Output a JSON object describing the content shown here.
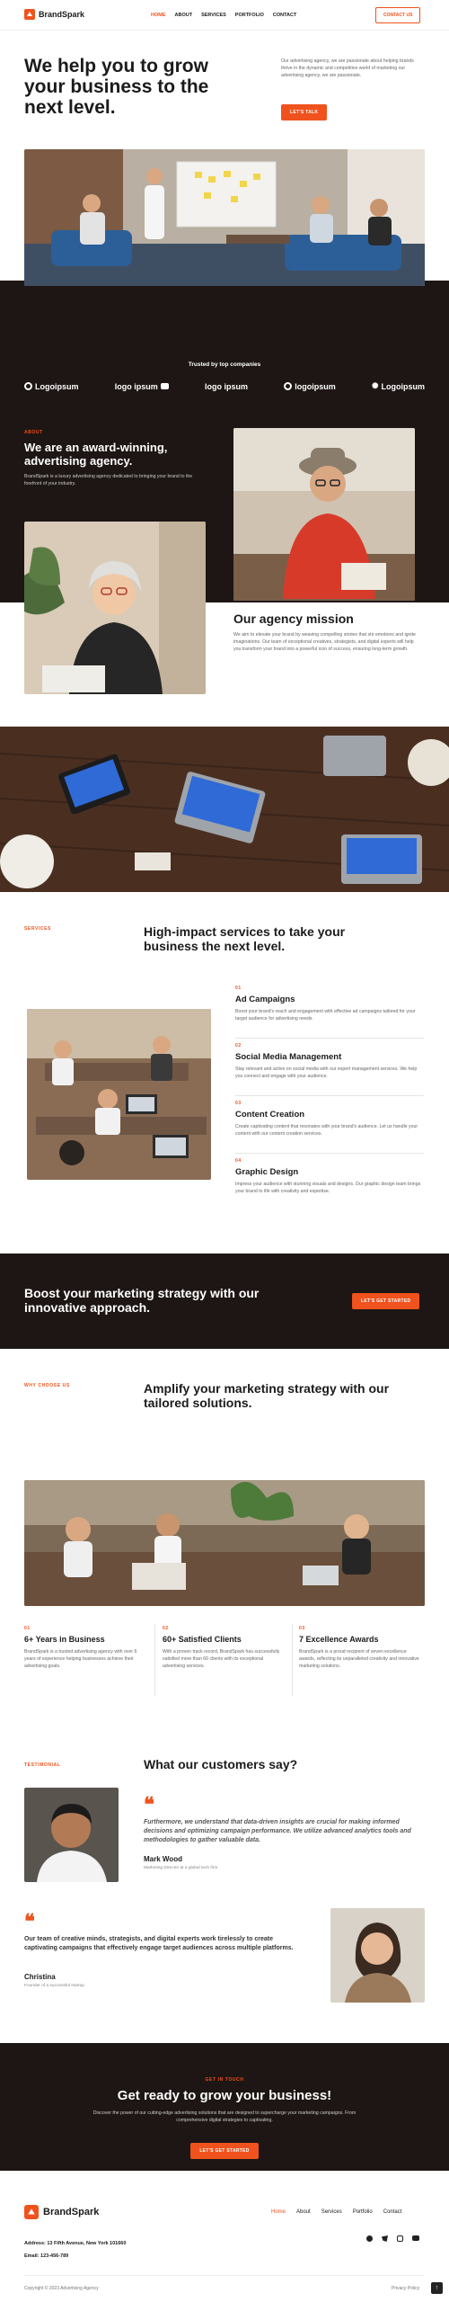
{
  "nav": {
    "brand": "BrandSpark",
    "links": [
      "HOME",
      "ABOUT",
      "SERVICES",
      "PORTFOLIO",
      "CONTACT"
    ],
    "cta": "CONTACT US"
  },
  "hero": {
    "title": "We help you to grow your business to the next level.",
    "text": "Our advertising agency, we are passionate about helping brands thrive in the dynamic and competitive world of marketing our advertising agency, we are passionate.",
    "cta": "LET'S TALK"
  },
  "trusted": {
    "title": "Trusted by top companies",
    "logos": [
      "Logoipsum",
      "logo ipsum",
      "logo ipsum",
      "logoipsum",
      "Logoipsum"
    ]
  },
  "about": {
    "tag": "ABOUT",
    "title": "We are an award-winning, advertising agency.",
    "text": "BrandSpark is a luxury advertising agency dedicated to bringing your brand to the forefront of your industry.",
    "mission_title": "Our agency mission",
    "mission_text": "We aim to elevate your brand by weaving compelling stories that stir emotions and ignite imaginations. Our team of exceptional creatives, strategists, and digital experts will help you transform your brand into a powerful icon of success, ensuring long-term growth."
  },
  "services": {
    "tag": "SERVICES",
    "title": "High-impact services to take your business the next level.",
    "items": [
      {
        "num": "01",
        "title": "Ad Campaigns",
        "text": "Boost your brand's reach and engagement with effective ad campaigns tailored for your target audience for advertising needs."
      },
      {
        "num": "02",
        "title": "Social Media Management",
        "text": "Stay relevant and active on social media with our expert management services. We help you connect and engage with your audience."
      },
      {
        "num": "03",
        "title": "Content Creation",
        "text": "Create captivating content that resonates with your brand's audience. Let us handle your content with our content creation services."
      },
      {
        "num": "04",
        "title": "Graphic Design",
        "text": "Impress your audience with stunning visuals and designs. Our graphic design team brings your brand to life with creativity and expertise."
      }
    ]
  },
  "cta_band": {
    "title": "Boost your marketing strategy with our innovative approach.",
    "cta": "LET'S GET STARTED"
  },
  "why": {
    "tag": "WHY CHOOSE US",
    "title": "Amplify your marketing strategy with our tailored solutions.",
    "items": [
      {
        "num": "01",
        "title": "6+ Years in Business",
        "text": "BrandSpark is a trusted advertising agency with over 6 years of experience helping businesses achieve their advertising goals."
      },
      {
        "num": "02",
        "title": "60+ Satisfied Clients",
        "text": "With a proven track record, BrandSpark has successfully satisfied more than 60 clients with its exceptional advertising services."
      },
      {
        "num": "03",
        "title": "7 Excellence Awards",
        "text": "BrandSpark is a proud recipient of seven excellence awards, reflecting its unparalleled creativity and innovative marketing solutions."
      }
    ]
  },
  "testimonials": {
    "tag": "TESTIMONIAL",
    "title": "What our customers say?",
    "items": [
      {
        "quote": "Furthermore, we understand that data-driven insights are crucial for making informed decisions and optimizing campaign performance. We utilize advanced analytics tools and methodologies to gather valuable data.",
        "name": "Mark Wood",
        "role": "Marketing Director at a global tech firm"
      },
      {
        "quote": "Our team of creative minds, strategists, and digital experts work tirelessly to create captivating campaigns that effectively engage target audiences across multiple platforms.",
        "name": "Christina",
        "role": "Founder of a successful startup"
      }
    ]
  },
  "contact": {
    "tag": "GET IN TOUCH",
    "title": "Get ready to grow your business!",
    "text": "Discover the power of our cutting-edge advertising solutions that are designed to supercharge your marketing campaigns. From comprehensive digital strategies to captivating.",
    "cta": "LET'S GET STARTED"
  },
  "footer": {
    "brand": "BrandSpark",
    "links": [
      "Home",
      "About",
      "Services",
      "Portfolio",
      "Contact"
    ],
    "address": "Address: 13 Fifth Avenue, New York 101660",
    "email": "Email: 123-456-789",
    "copyright": "Copyright © 2023 Advertising Agency",
    "privacy": "Privacy Policy"
  },
  "colors": {
    "accent": "#f0521d",
    "dark": "#1d1614"
  },
  "icons": [
    "brand-logo-icon",
    "quote-icon",
    "facebook-icon",
    "twitter-icon",
    "instagram-icon",
    "youtube-icon",
    "scroll-top-icon"
  ]
}
